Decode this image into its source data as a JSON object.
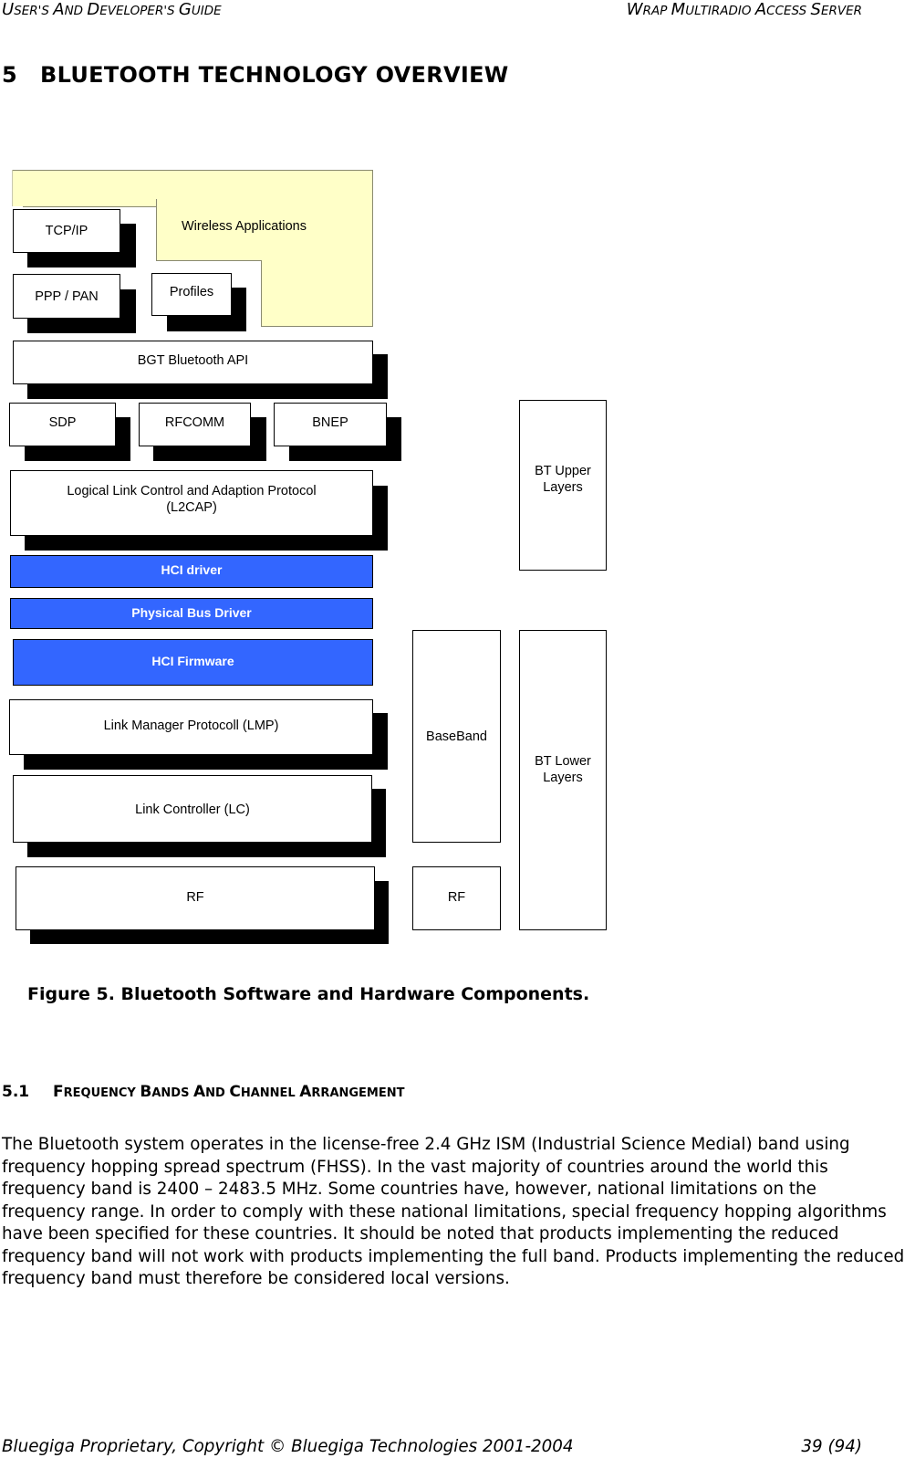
{
  "header": {
    "left": "User's And Developer's Guide",
    "right": "WRAP Multiradio Access Server"
  },
  "section": {
    "number": "5",
    "title": "BLUETOOTH TECHNOLOGY OVERVIEW"
  },
  "diagram": {
    "wireless_applications": "Wireless Applications",
    "tcp_ip": "TCP/IP",
    "ppp_pan": "PPP / PAN",
    "profiles": "Profiles",
    "bgt_api": "BGT Bluetooth API",
    "sdp": "SDP",
    "rfcomm": "RFCOMM",
    "bnep": "BNEP",
    "l2cap_line1": "Logical Link Control and Adaption Protocol",
    "l2cap_line2": "(L2CAP)",
    "hci_driver": "HCI driver",
    "physical_bus_driver": "Physical Bus Driver",
    "hci_firmware": "HCI Firmware",
    "lmp": "Link Manager Protocoll (LMP)",
    "lc": "Link Controller (LC)",
    "rf_left": "RF",
    "baseband": "BaseBand",
    "rf_right": "RF",
    "bt_upper_line1": "BT Upper",
    "bt_upper_line2": "Layers",
    "bt_lower_line1": "BT Lower",
    "bt_lower_line2": "Layers",
    "colors": {
      "hci_blue": "#3366ff",
      "applications_yellow": "#ffffc8"
    }
  },
  "figure_caption": "Figure 5. Bluetooth Software and Hardware Components.",
  "subsection": {
    "number": "5.1",
    "title": "Frequency Bands and Channel Arrangement"
  },
  "body": {
    "paragraph": "The Bluetooth system operates in the license-free 2.4 GHz ISM (Industrial Science Medial) band using frequency hopping spread spectrum (FHSS). In the vast majority of countries around the world this frequency band is 2400 – 2483.5 MHz. Some countries have, however, national limitations on the frequency range. In order to comply with these national limitations, special frequency hopping algorithms have been specified for these countries. It should be noted that products implementing the reduced frequency band will not work with products implementing the full band. Products implementing the reduced frequency band must therefore be considered local versions."
  },
  "footer": {
    "left": "Bluegiga Proprietary, Copyright © Bluegiga Technologies 2001-2004",
    "right": "39 (94)"
  }
}
